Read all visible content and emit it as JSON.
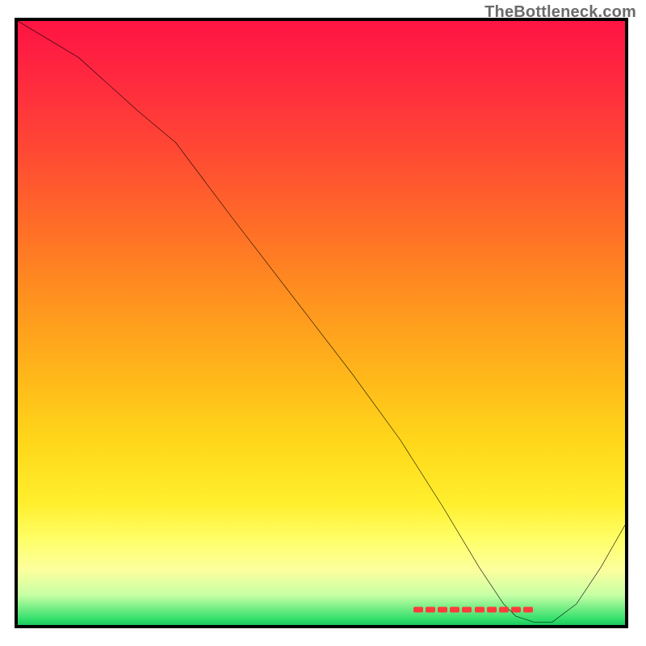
{
  "watermark": "TheBottleneck.com",
  "chart_data": {
    "type": "line",
    "title": "",
    "xlabel": "",
    "ylabel": "",
    "xlim": [
      0,
      100
    ],
    "ylim": [
      0,
      100
    ],
    "grid": false,
    "curve": {
      "x": [
        0,
        10,
        20,
        26,
        35,
        45,
        55,
        63,
        70,
        76,
        80,
        82,
        85,
        88,
        92,
        96,
        100
      ],
      "y": [
        100,
        94,
        85,
        80,
        68,
        55,
        42,
        31,
        20,
        10,
        4,
        2,
        1,
        1,
        4,
        10,
        17
      ]
    },
    "markers": {
      "y": 1.5,
      "x": [
        66,
        68,
        70,
        72,
        74,
        76,
        78,
        80,
        82,
        84
      ]
    },
    "colors": {
      "curve": "#000000",
      "marker": "#ff3b3b",
      "gradient_top": "#ff1443",
      "gradient_mid": "#ffd81a",
      "gradient_bottom": "#1ac95f"
    }
  }
}
